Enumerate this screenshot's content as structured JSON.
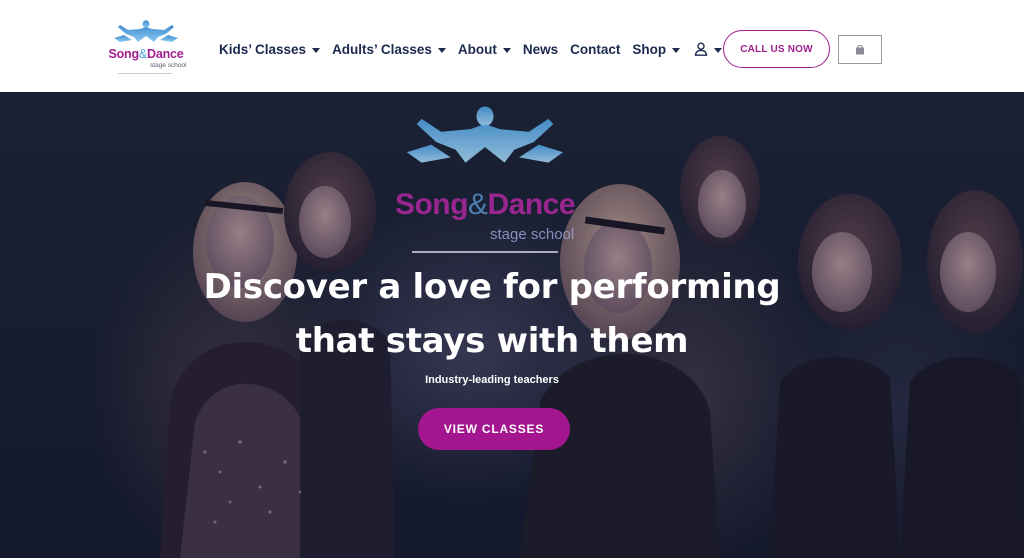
{
  "brand": {
    "logo_song": "Song",
    "logo_amp": "&",
    "logo_dance": "Dance",
    "logo_sub": "stage school",
    "colors": {
      "primary": "#a0218f",
      "accent": "#4fa3dc",
      "nav_text": "#1b2a4e"
    }
  },
  "nav": {
    "items": [
      {
        "label": "Kids’ Classes",
        "dropdown": true
      },
      {
        "label": "Adults’ Classes",
        "dropdown": true
      },
      {
        "label": "About",
        "dropdown": true
      },
      {
        "label": "News",
        "dropdown": false
      },
      {
        "label": "Contact",
        "dropdown": false
      },
      {
        "label": "Shop",
        "dropdown": true
      }
    ],
    "account_icon": "user-icon",
    "call_label": "CALL US NOW",
    "cart_icon": "shopping-bag-icon"
  },
  "hero": {
    "logo_song": "Song",
    "logo_amp": "&",
    "logo_dance": "Dance",
    "logo_sub": "stage school",
    "headline_line1": "Discover a love for performing",
    "headline_line2": "that stays with them",
    "tagline": "Industry-leading teachers",
    "cta_label": "VIEW CLASSES"
  }
}
